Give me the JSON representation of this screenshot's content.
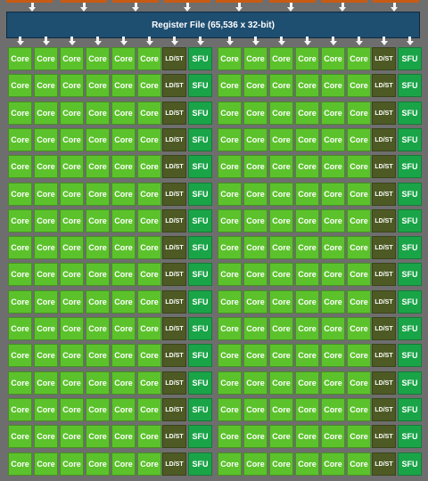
{
  "register_file": {
    "label": "Register File (65,536 x 32-bit)"
  },
  "unit_labels": {
    "core": "Core",
    "ldst": "LD/ST",
    "sfu": "SFU"
  },
  "row_pattern": [
    "core",
    "core",
    "core",
    "core",
    "core",
    "core",
    "ldst",
    "sfu",
    "core",
    "core",
    "core",
    "core",
    "core",
    "core",
    "ldst",
    "sfu"
  ],
  "row_count": 16,
  "colors": {
    "background": "#6e6e6e",
    "register_file": "#1e4e70",
    "core": "#5cc22c",
    "ldst": "#4e5a24",
    "sfu": "#1aa448",
    "dispatch_block": "#c75b14",
    "arrow": "#f4f4f4"
  }
}
